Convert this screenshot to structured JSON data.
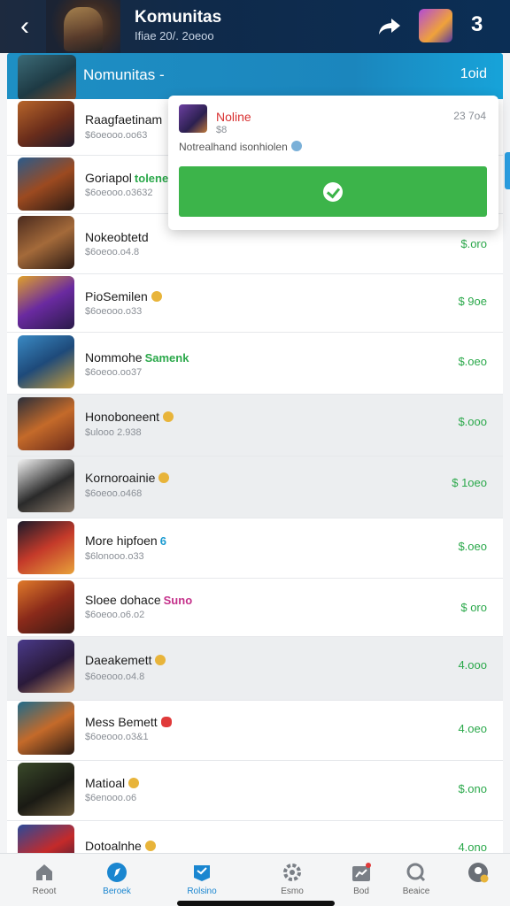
{
  "header": {
    "title": "Komunitas",
    "subtitle": "Ifiae 20/. 2oeoo",
    "count": "3"
  },
  "section": {
    "label": "Nomunitas -",
    "total": "1oid"
  },
  "popup": {
    "title": "Noline",
    "subtitle": "$8",
    "number": "23 7o4",
    "description": "Notrealhand isonhiolen"
  },
  "rows": [
    {
      "name": "Raagfaetinam",
      "tag": "",
      "sub": "$6oeooo.oo63",
      "value": ""
    },
    {
      "name": "Goriapol",
      "tag": "tolene",
      "sub": "$6oeooo.o3632",
      "value": ""
    },
    {
      "name": "Nokeobtetd",
      "tag": "",
      "sub": "$6oeoo.o4.8",
      "value": "$.oro"
    },
    {
      "name": "PioSemilen",
      "tag": "",
      "sub": "$6oeooo.o33",
      "value": "$ 9oe"
    },
    {
      "name": "Nommohe",
      "tag": "Samenk",
      "sub": "$6oeoo.oo37",
      "value": "$.oeo"
    },
    {
      "name": "Honoboneent",
      "tag": "",
      "sub": "$ulooo 2.938",
      "value": "$.ooo"
    },
    {
      "name": "Kornoroainie",
      "tag": "",
      "sub": "$6oeoo.o468",
      "value": "$ 1oeo"
    },
    {
      "name": "More hipfoen",
      "tag": "6",
      "sub": "$6lonooo.o33",
      "value": "$.oeo"
    },
    {
      "name": "Sloee dohace",
      "tag": "Suno",
      "sub": "$6oeoo.o6.o2",
      "value": "$ oro"
    },
    {
      "name": "Daeakemett",
      "tag": "",
      "sub": "$6oeooo.o4.8",
      "value": "4.ooo"
    },
    {
      "name": "Mess Bemett",
      "tag": "",
      "sub": "$6oeooo.o3&1",
      "value": "4.oeo"
    },
    {
      "name": "Matioal",
      "tag": "",
      "sub": "$6enooo.o6",
      "value": "$.ono"
    },
    {
      "name": "Dotoalnhe",
      "tag": "",
      "sub": "",
      "value": "4.ono"
    }
  ],
  "nav": [
    {
      "label": "Reoot",
      "icon": "home-icon"
    },
    {
      "label": "Beroek",
      "icon": "compass-icon"
    },
    {
      "label": "Rolsino",
      "icon": "flag-icon"
    },
    {
      "label": "Esmo",
      "icon": "gear-icon"
    },
    {
      "label": "Bod",
      "icon": "chart-icon"
    },
    {
      "label": "Beaice",
      "icon": "search-icon"
    },
    {
      "label": "",
      "icon": "profile-icon"
    }
  ],
  "colors": {
    "accent": "#1e8fc4",
    "positive": "#2aa84a",
    "button": "#3cb44a",
    "alert": "#d83030"
  }
}
